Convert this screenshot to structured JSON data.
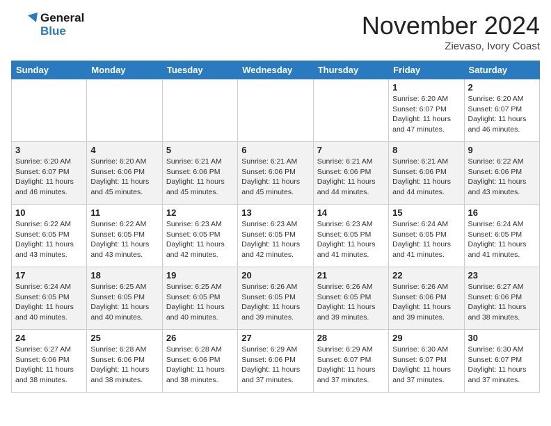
{
  "header": {
    "logo_line1": "General",
    "logo_line2": "Blue",
    "month_title": "November 2024",
    "location": "Zievaso, Ivory Coast"
  },
  "weekdays": [
    "Sunday",
    "Monday",
    "Tuesday",
    "Wednesday",
    "Thursday",
    "Friday",
    "Saturday"
  ],
  "weeks": [
    [
      {
        "day": "",
        "info": ""
      },
      {
        "day": "",
        "info": ""
      },
      {
        "day": "",
        "info": ""
      },
      {
        "day": "",
        "info": ""
      },
      {
        "day": "",
        "info": ""
      },
      {
        "day": "1",
        "info": "Sunrise: 6:20 AM\nSunset: 6:07 PM\nDaylight: 11 hours\nand 47 minutes."
      },
      {
        "day": "2",
        "info": "Sunrise: 6:20 AM\nSunset: 6:07 PM\nDaylight: 11 hours\nand 46 minutes."
      }
    ],
    [
      {
        "day": "3",
        "info": "Sunrise: 6:20 AM\nSunset: 6:07 PM\nDaylight: 11 hours\nand 46 minutes."
      },
      {
        "day": "4",
        "info": "Sunrise: 6:20 AM\nSunset: 6:06 PM\nDaylight: 11 hours\nand 45 minutes."
      },
      {
        "day": "5",
        "info": "Sunrise: 6:21 AM\nSunset: 6:06 PM\nDaylight: 11 hours\nand 45 minutes."
      },
      {
        "day": "6",
        "info": "Sunrise: 6:21 AM\nSunset: 6:06 PM\nDaylight: 11 hours\nand 45 minutes."
      },
      {
        "day": "7",
        "info": "Sunrise: 6:21 AM\nSunset: 6:06 PM\nDaylight: 11 hours\nand 44 minutes."
      },
      {
        "day": "8",
        "info": "Sunrise: 6:21 AM\nSunset: 6:06 PM\nDaylight: 11 hours\nand 44 minutes."
      },
      {
        "day": "9",
        "info": "Sunrise: 6:22 AM\nSunset: 6:06 PM\nDaylight: 11 hours\nand 43 minutes."
      }
    ],
    [
      {
        "day": "10",
        "info": "Sunrise: 6:22 AM\nSunset: 6:05 PM\nDaylight: 11 hours\nand 43 minutes."
      },
      {
        "day": "11",
        "info": "Sunrise: 6:22 AM\nSunset: 6:05 PM\nDaylight: 11 hours\nand 43 minutes."
      },
      {
        "day": "12",
        "info": "Sunrise: 6:23 AM\nSunset: 6:05 PM\nDaylight: 11 hours\nand 42 minutes."
      },
      {
        "day": "13",
        "info": "Sunrise: 6:23 AM\nSunset: 6:05 PM\nDaylight: 11 hours\nand 42 minutes."
      },
      {
        "day": "14",
        "info": "Sunrise: 6:23 AM\nSunset: 6:05 PM\nDaylight: 11 hours\nand 41 minutes."
      },
      {
        "day": "15",
        "info": "Sunrise: 6:24 AM\nSunset: 6:05 PM\nDaylight: 11 hours\nand 41 minutes."
      },
      {
        "day": "16",
        "info": "Sunrise: 6:24 AM\nSunset: 6:05 PM\nDaylight: 11 hours\nand 41 minutes."
      }
    ],
    [
      {
        "day": "17",
        "info": "Sunrise: 6:24 AM\nSunset: 6:05 PM\nDaylight: 11 hours\nand 40 minutes."
      },
      {
        "day": "18",
        "info": "Sunrise: 6:25 AM\nSunset: 6:05 PM\nDaylight: 11 hours\nand 40 minutes."
      },
      {
        "day": "19",
        "info": "Sunrise: 6:25 AM\nSunset: 6:05 PM\nDaylight: 11 hours\nand 40 minutes."
      },
      {
        "day": "20",
        "info": "Sunrise: 6:26 AM\nSunset: 6:05 PM\nDaylight: 11 hours\nand 39 minutes."
      },
      {
        "day": "21",
        "info": "Sunrise: 6:26 AM\nSunset: 6:05 PM\nDaylight: 11 hours\nand 39 minutes."
      },
      {
        "day": "22",
        "info": "Sunrise: 6:26 AM\nSunset: 6:06 PM\nDaylight: 11 hours\nand 39 minutes."
      },
      {
        "day": "23",
        "info": "Sunrise: 6:27 AM\nSunset: 6:06 PM\nDaylight: 11 hours\nand 38 minutes."
      }
    ],
    [
      {
        "day": "24",
        "info": "Sunrise: 6:27 AM\nSunset: 6:06 PM\nDaylight: 11 hours\nand 38 minutes."
      },
      {
        "day": "25",
        "info": "Sunrise: 6:28 AM\nSunset: 6:06 PM\nDaylight: 11 hours\nand 38 minutes."
      },
      {
        "day": "26",
        "info": "Sunrise: 6:28 AM\nSunset: 6:06 PM\nDaylight: 11 hours\nand 38 minutes."
      },
      {
        "day": "27",
        "info": "Sunrise: 6:29 AM\nSunset: 6:06 PM\nDaylight: 11 hours\nand 37 minutes."
      },
      {
        "day": "28",
        "info": "Sunrise: 6:29 AM\nSunset: 6:07 PM\nDaylight: 11 hours\nand 37 minutes."
      },
      {
        "day": "29",
        "info": "Sunrise: 6:30 AM\nSunset: 6:07 PM\nDaylight: 11 hours\nand 37 minutes."
      },
      {
        "day": "30",
        "info": "Sunrise: 6:30 AM\nSunset: 6:07 PM\nDaylight: 11 hours\nand 37 minutes."
      }
    ]
  ]
}
